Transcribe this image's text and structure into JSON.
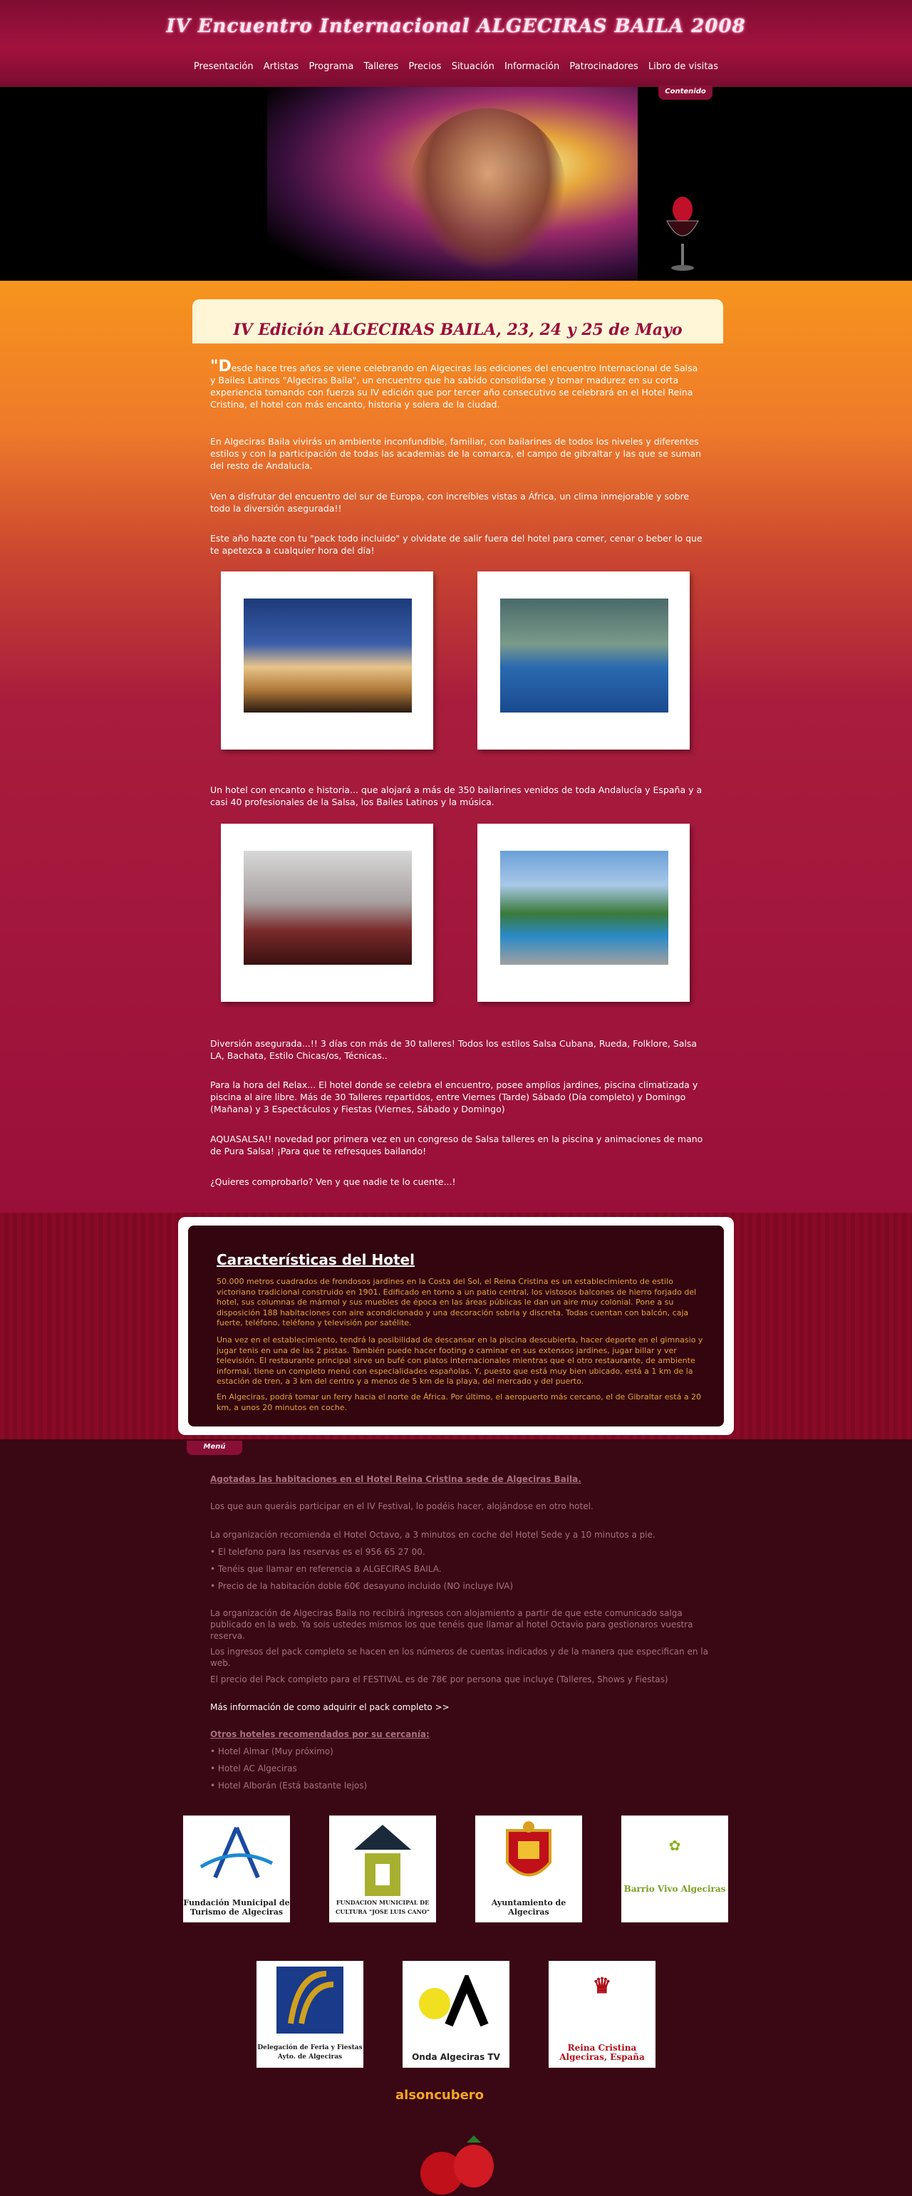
{
  "header": {
    "title": "IV Encuentro Internacional ALGECIRAS BAILA 2008",
    "nav": [
      "Presentación",
      "Artistas",
      "Programa",
      "Talleres",
      "Precios",
      "Situación",
      "Información",
      "Patrocinadores",
      "Libro de visitas"
    ]
  },
  "hero": {
    "tab_label": "Contenido"
  },
  "main": {
    "title": "IV Edición ALGECIRAS BAILA, 23, 24 y 25 de Mayo",
    "intro_quote": "\"D",
    "p1": "esde hace tres años se viene celebrando en Algeciras las ediciones del encuentro Internacional de Salsa y Bailes Latinos \"Algeciras Baila\", un encuentro que ha sabido consolidarse y tomar madurez en su corta experiencia tomando con fuerza su IV edición que por tercer año consecutivo se celebrará en el Hotel Reina Cristina, el hotel con más encanto, historia y solera de la ciudad.",
    "p2": "En Algeciras Baila vivirás un ambiente inconfundible, familiar, con bailarines de todos los niveles y diferentes estilos y con la participación de todas las academias de la comarca, el campo de gibraltar y las que se suman del resto de Andalucía.",
    "p3": "Ven a disfrutar del encuentro del sur de Europa, con increíbles vistas a África, un clima inmejorable y sobre todo la diversión asegurada!!",
    "p4": "Este año hazte con tu \"pack todo incluido\" y olvidate de salir fuera del hotel para comer, cenar o beber lo que te apetezca a cualquier hora del día!",
    "p5": "Un hotel con encanto e historia... que alojará a más de 350 bailarines venidos de toda Andalucía y España y a casi 40 profesionales de la Salsa, los Bailes Latinos y la música.",
    "p6": "Diversión asegurada...!! 3 días con más de 30 talleres! Todos los estilos Salsa Cubana, Rueda, Folklore, Salsa LA, Bachata, Estilo Chicas/os, Técnicas..",
    "p7": "Para la hora del Relax... El hotel donde se celebra el encuentro, posee amplios jardines, piscina climatizada y piscina al aire libre. Más de 30 Talleres repartidos, entre Viernes (Tarde) Sábado (Día completo) y Domingo (Mañana) y 3 Espectáculos y Fiestas (Viernes, Sábado y Domingo)",
    "p8": "AQUASALSA!! novedad por primera vez en un congreso de Salsa talleres en la piscina y animaciones de mano de Pura Salsa! ¡Para que te refresques bailando!",
    "p9": "¿Quieres comprobarlo? Ven y que nadie te lo cuente...!"
  },
  "characteristics": {
    "title": "Características del Hotel",
    "c1": "50.000 metros cuadrados de frondosos jardines en la Costa del Sol, el Reina Cristina es un establecimiento de estilo victoriano tradicional construido en 1901. Edificado en torno a un patio central, los vistosos balcones de hierro forjado del hotel, sus columnas de mármol y sus muebles de época en las áreas públicas le dan un aire muy colonial. Pone a su disposición 188 habitaciones con aire acondicionado y una decoración sobria y discreta. Todas cuentan con balcón, caja fuerte, teléfono, teléfono y televisión por satélite.",
    "c2": "Una vez en el establecimiento, tendrá la posibilidad de descansar en la piscina descubierta, hacer deporte en el gimnasio y jugar tenis en una de las 2 pistas. También puede hacer footing o caminar en sus extensos jardines, jugar billar y ver televisión. El restaurante principal sirve un bufé con platos internacionales mientras que el otro restaurante, de ambiente informal, tiene un completo menú con especialidades españolas. Y, puesto que está muy bien ubicado, está a 1 km de la estación de tren, a 3 km del centro y a menos de 5 km de la playa, del mercado y del puerto.",
    "c3": "En Algeciras, podrá tomar un ferry hacia el norte de África. Por último, el aeropuerto más cercano, el de Gibraltar está a 20 km, a unos 20 minutos en coche."
  },
  "menu": {
    "tab_label": "Menú",
    "m1": "Agotadas las habitaciones en el Hotel Reina Cristina sede de Algeciras Baila.",
    "m2": "Los que aun queráis participar en el IV Festival, lo podéis hacer, alojándose en otro hotel.",
    "m3": "La organización recomienda el Hotel Octavo, a 3 minutos en coche del Hotel Sede y a 10 minutos a pie.",
    "bullets1": [
      "• El telefono para las reservas es el 956 65 27 00.",
      "• Tenéis que llamar en referencia a ALGECIRAS BAILA.",
      "• Precio de la habitación doble 60€ desayuno incluido (NO incluye IVA)"
    ],
    "m4": "La organización de Algeciras Baila no recibirá ingresos con alojamiento a partir de que este comunicado salga publicado en la web. Ya sois ustedes mismos los que tenéis que llamar al hotel Octavio para gestionaros vuestra reserva.",
    "m5": "Los ingresos del pack completo se hacen en los números de cuentas indicados y de la manera que especifican en la web.",
    "m6": "El precio del Pack completo para el FESTIVAL es de 78€ por persona que incluye (Talleres, Shows y Fiestas)",
    "m7": "Más información de como adquirir el pack completo >>",
    "m8": "Otros hoteles recomendados por su cercanía:",
    "bullets2": [
      "• Hotel Almar (Muy próximo)",
      "• Hotel AC Algeciras",
      "• Hotel Alborán (Está bastante lejos)"
    ]
  },
  "sponsors": [
    "Fundación Municipal de Turismo de Algeciras",
    "FUNDACION MUNICIPAL DE CULTURA \"JOSE LUIS CANO\"",
    "Ayuntamiento de Algeciras",
    "Barrio Vivo Algeciras",
    "Delegación de Feria y Fiestas Ayto. de Algeciras",
    "Onda Algeciras TV",
    "Reina Cristina Algeciras, España"
  ],
  "footer": {
    "brand": "alsoncubero"
  },
  "colors": {
    "accent": "#9a0f3a",
    "orange": "#f7941d",
    "gold_text": "#e7a23a"
  }
}
